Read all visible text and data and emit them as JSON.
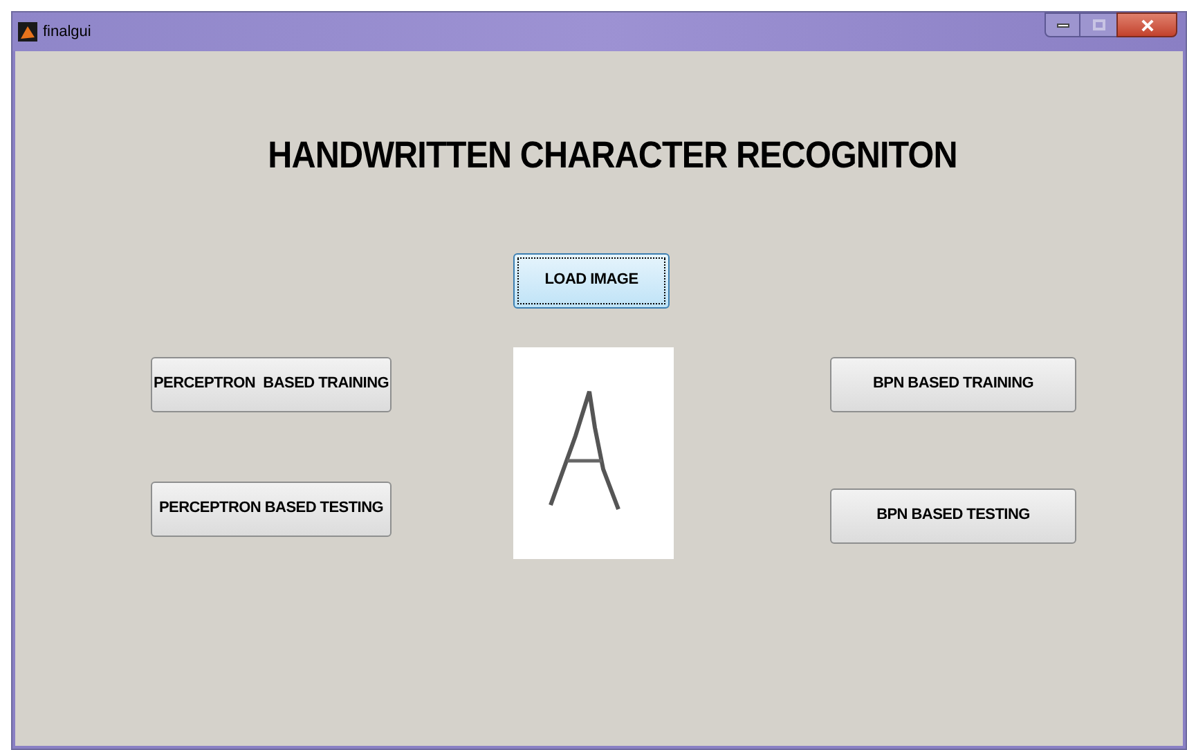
{
  "window": {
    "title": "finalgui"
  },
  "heading": "HANDWRITTEN CHARACTER RECOGNITON",
  "load_button": {
    "label": "LOAD IMAGE",
    "focused": true
  },
  "left_buttons": [
    {
      "label": "PERCEPTRON  BASED TRAINING"
    },
    {
      "label": "PERCEPTRON BASED TESTING"
    }
  ],
  "right_buttons": [
    {
      "label": "BPN BASED TRAINING"
    },
    {
      "label": "BPN BASED TESTING"
    }
  ]
}
